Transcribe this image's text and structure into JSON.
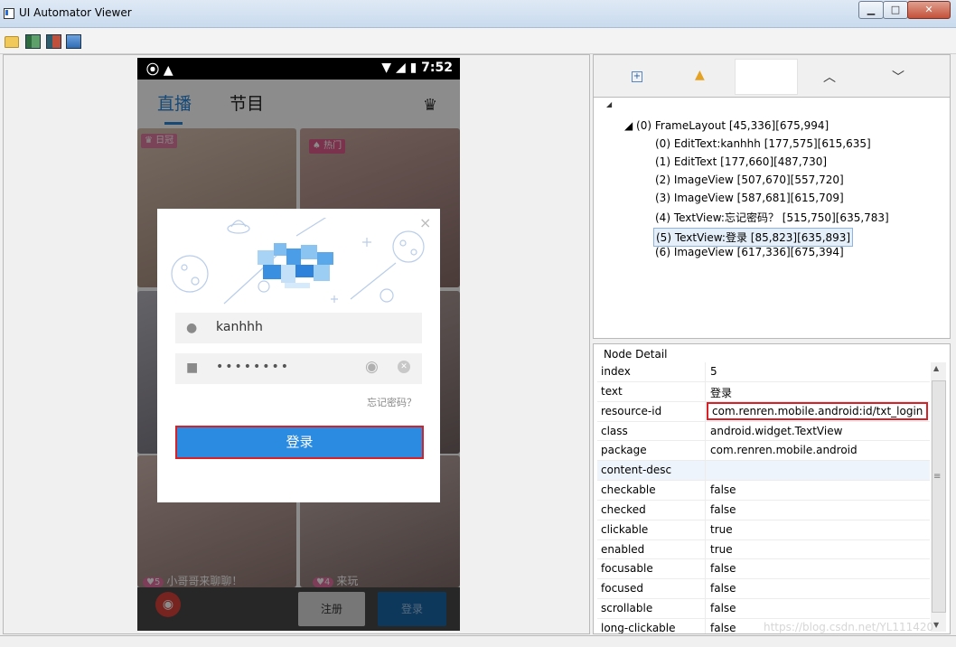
{
  "window": {
    "title": "UI Automator Viewer",
    "min_label": "▁",
    "max_label": "□",
    "close_label": "✕"
  },
  "phone": {
    "status_time": "7:52",
    "status_left": "⦿ ▲",
    "status_icons": "▼ ◢ ▮",
    "tab_live": "直播",
    "tab_shows": "节目",
    "tag1": "♛ 日冠",
    "tag2": "♠ 热门",
    "caption1": {
      "badge": "♥5",
      "text": "小哥哥来聊聊！"
    },
    "caption2": {
      "badge": "♥4",
      "text": "来玩"
    },
    "register_label": "注册",
    "bottom_login_label": "登录",
    "dialog": {
      "close": "×",
      "username": "kanhhh",
      "password_mask": "••••••••",
      "forgot": "忘记密码？",
      "login_label": "登录"
    }
  },
  "tree": {
    "root": "◢",
    "frame": "◢ (0) FrameLayout [45,336][675,994]",
    "nodes": [
      "(0) EditText:kanhhh [177,575][615,635]",
      "(1) EditText [177,660][487,730]",
      "(2) ImageView [507,670][557,720]",
      "(3) ImageView [587,681][615,709]",
      "(4) TextView:忘记密码？ [515,750][635,783]",
      "(5) TextView:登录 [85,823][635,893]",
      "(6) ImageView [617,336][675,394]"
    ]
  },
  "detail": {
    "title": "Node Detail",
    "rows": [
      {
        "key": "index",
        "value": "5"
      },
      {
        "key": "text",
        "value": "登录"
      },
      {
        "key": "resource-id",
        "value": "com.renren.mobile.android:id/txt_login"
      },
      {
        "key": "class",
        "value": "android.widget.TextView"
      },
      {
        "key": "package",
        "value": "com.renren.mobile.android"
      },
      {
        "key": "content-desc",
        "value": ""
      },
      {
        "key": "checkable",
        "value": "false"
      },
      {
        "key": "checked",
        "value": "false"
      },
      {
        "key": "clickable",
        "value": "true"
      },
      {
        "key": "enabled",
        "value": "true"
      },
      {
        "key": "focusable",
        "value": "false"
      },
      {
        "key": "focused",
        "value": "false"
      },
      {
        "key": "scrollable",
        "value": "false"
      },
      {
        "key": "long-clickable",
        "value": "false"
      }
    ]
  },
  "watermark": "https://blog.csdn.net/YL111420"
}
